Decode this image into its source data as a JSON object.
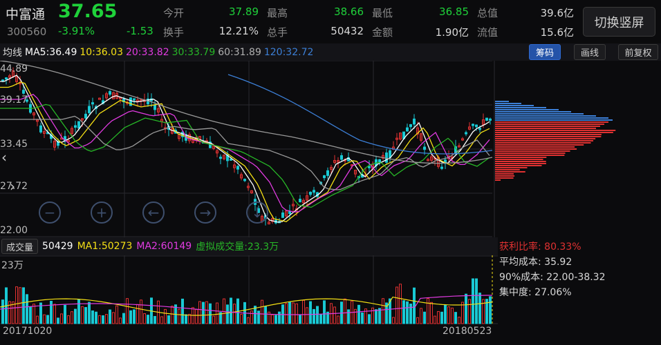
{
  "stock": {
    "name": "中富通",
    "price": "37.65",
    "code": "300560",
    "change_pct": "-3.91%",
    "change": "-1.53"
  },
  "quote": [
    {
      "label": "今开",
      "value": "37.89",
      "color": "grn"
    },
    {
      "label": "最高",
      "value": "38.66",
      "color": "grn"
    },
    {
      "label": "最低",
      "value": "36.85",
      "color": "grn"
    },
    {
      "label": "总值",
      "value": "39.6亿",
      "color": "wht"
    },
    {
      "label": "换手",
      "value": "12.21%",
      "color": "wht"
    },
    {
      "label": "总手",
      "value": "50432",
      "color": "wht"
    },
    {
      "label": "金额",
      "value": "1.90亿",
      "color": "wht"
    },
    {
      "label": "流值",
      "value": "15.6亿",
      "color": "wht"
    }
  ],
  "switch_label": "切换竖屏",
  "ma": {
    "title": "均线",
    "ma5": "MA5:36.49",
    "ma10": "10:36.03",
    "ma20": "20:33.82",
    "ma30": "30:33.79",
    "ma60": "60:31.89",
    "ma120": "120:32.72"
  },
  "toolbar": {
    "chips": "筹码",
    "draw": "画线",
    "adjust": "前复权"
  },
  "y_axis": [
    "44.89",
    "39.17",
    "33.45",
    "27.72",
    "22.00"
  ],
  "volume": {
    "button": "成交量",
    "value": "50429",
    "ma1": "MA1:50273",
    "ma2": "MA2:60149",
    "virtual": "虚拟成交量:23.3万",
    "axis_top": "23万"
  },
  "chips_stats": {
    "profit": "获利比率: 80.33%",
    "avg_cost": "平均成本: 35.92",
    "cost90": "90%成本: 22.00-38.32",
    "concentration": "集中度: 27.06%"
  },
  "dates": {
    "start": "20171020",
    "end": "20180523"
  },
  "colors": {
    "up": "#e03131",
    "down": "#19c9d4",
    "ma5": "#ffffff",
    "ma10": "#f5e015",
    "ma20": "#e23be2",
    "ma30": "#27b727",
    "ma60": "#9a9a9a",
    "ma120": "#3c7fd6"
  },
  "nav_icons": [
    "minus-icon",
    "plus-icon",
    "arrow-left-icon",
    "arrow-right-icon",
    "arrow-down-icon"
  ]
}
